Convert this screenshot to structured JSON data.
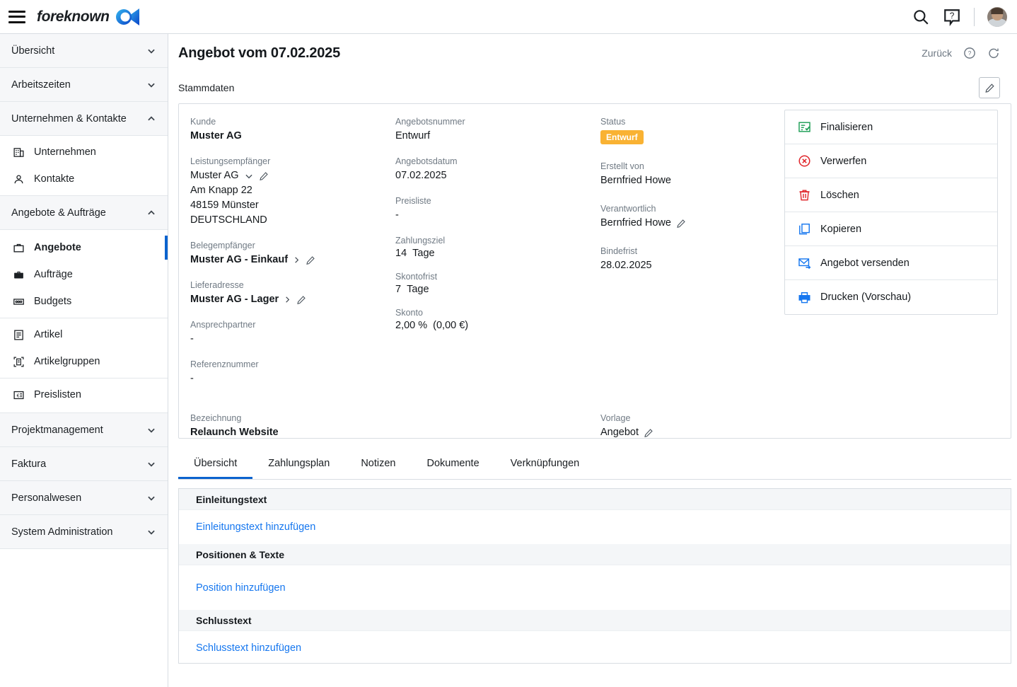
{
  "topbar": {
    "menu_icon": "hamburger-icon",
    "brand_name": "foreknown",
    "search_icon": "search-icon",
    "help_icon": "help-speech-bubble-icon",
    "avatar": "user-avatar"
  },
  "sidebar": {
    "groups": [
      {
        "label": "Übersicht",
        "expanded": false,
        "items": []
      },
      {
        "label": "Arbeitszeiten",
        "expanded": false,
        "items": []
      },
      {
        "label": "Unternehmen & Kontakte",
        "expanded": true,
        "items": [
          {
            "label": "Unternehmen",
            "icon": "building-icon",
            "active": false
          },
          {
            "label": "Kontakte",
            "icon": "person-icon",
            "active": false
          }
        ]
      },
      {
        "label": "Angebote & Aufträge",
        "expanded": true,
        "items": [
          {
            "label": "Angebote",
            "icon": "briefcase-outline-icon",
            "active": true
          },
          {
            "label": "Aufträge",
            "icon": "briefcase-filled-icon",
            "active": false
          },
          {
            "label": "Budgets",
            "icon": "banknote-icon",
            "active": false
          },
          {
            "label": "Artikel",
            "icon": "document-lines-icon",
            "active": false
          },
          {
            "label": "Artikelgruppen",
            "icon": "document-group-icon",
            "active": false
          },
          {
            "label": "Preislisten",
            "icon": "price-tag-icon",
            "active": false
          }
        ]
      },
      {
        "label": "Projektmanagement",
        "expanded": false,
        "items": []
      },
      {
        "label": "Faktura",
        "expanded": false,
        "items": []
      },
      {
        "label": "Personalwesen",
        "expanded": false,
        "items": []
      },
      {
        "label": "System Administration",
        "expanded": false,
        "items": []
      }
    ]
  },
  "page": {
    "title": "Angebot vom 07.02.2025",
    "back_label": "Zurück",
    "help_icon": "help-circle-icon",
    "refresh_icon": "refresh-icon",
    "section_label": "Stammdaten",
    "edit_icon": "pencil-icon"
  },
  "master_data": {
    "col1": {
      "kunde_label": "Kunde",
      "kunde_value": "Muster AG",
      "leistungsempfaenger_label": "Leistungsempfänger",
      "leistungsempfaenger_value": "Muster AG",
      "address_line1": "Am Knapp 22",
      "address_line2": "48159 Münster",
      "address_line3": "DEUTSCHLAND",
      "belegempfaenger_label": "Belegempfänger",
      "belegempfaenger_value": "Muster AG - Einkauf",
      "lieferadresse_label": "Lieferadresse",
      "lieferadresse_value": "Muster AG - Lager",
      "ansprechpartner_label": "Ansprechpartner",
      "ansprechpartner_value": "-",
      "referenznummer_label": "Referenznummer",
      "referenznummer_value": "-"
    },
    "col2": {
      "angebotsnummer_label": "Angebotsnummer",
      "angebotsnummer_value": "Entwurf",
      "angebotsdatum_label": "Angebotsdatum",
      "angebotsdatum_value": "07.02.2025",
      "preisliste_label": "Preisliste",
      "preisliste_value": "-",
      "zahlungsziel_label": "Zahlungsziel",
      "zahlungsziel_value": "14",
      "zahlungsziel_unit": "Tage",
      "skontofrist_label": "Skontofrist",
      "skontofrist_value": "7",
      "skontofrist_unit": "Tage",
      "skonto_label": "Skonto",
      "skonto_value": "2,00 %",
      "skonto_amount": "(0,00 €)"
    },
    "col3": {
      "status_label": "Status",
      "status_value": "Entwurf",
      "status_color": "#f9b233",
      "erstellt_von_label": "Erstellt von",
      "erstellt_von_value": "Bernfried Howe",
      "verantwortlich_label": "Verantwortlich",
      "verantwortlich_value": "Bernfried Howe",
      "bindefrist_label": "Bindefrist",
      "bindefrist_value": "28.02.2025"
    },
    "bottom": {
      "bezeichnung_label": "Bezeichnung",
      "bezeichnung_value": "Relaunch Website",
      "vorlage_label": "Vorlage",
      "vorlage_value": "Angebot"
    }
  },
  "actions": [
    {
      "label": "Finalisieren",
      "icon": "list-check-icon",
      "color": "#1a9d53"
    },
    {
      "label": "Verwerfen",
      "icon": "circle-x-icon",
      "color": "#e0262b"
    },
    {
      "label": "Löschen",
      "icon": "trash-icon",
      "color": "#e0262b"
    },
    {
      "label": "Kopieren",
      "icon": "copy-icon",
      "color": "#1677ef"
    },
    {
      "label": "Angebot versenden",
      "icon": "mail-send-icon",
      "color": "#1677ef"
    },
    {
      "label": "Drucken (Vorschau)",
      "icon": "printer-icon",
      "color": "#1677ef"
    }
  ],
  "tabs": [
    {
      "label": "Übersicht",
      "active": true
    },
    {
      "label": "Zahlungsplan",
      "active": false
    },
    {
      "label": "Notizen",
      "active": false
    },
    {
      "label": "Dokumente",
      "active": false
    },
    {
      "label": "Verknüpfungen",
      "active": false
    }
  ],
  "overview_sections": [
    {
      "heading": "Einleitungstext",
      "link": "Einleitungstext hinzufügen"
    },
    {
      "heading": "Positionen & Texte",
      "link": "Position hinzufügen"
    },
    {
      "heading": "Schlusstext",
      "link": "Schlusstext hinzufügen"
    }
  ],
  "colors": {
    "accent_blue": "#0b63ce",
    "link_blue": "#1677ef",
    "status_amber": "#f9b233",
    "danger_red": "#e0262b",
    "success_green": "#1a9d53"
  }
}
